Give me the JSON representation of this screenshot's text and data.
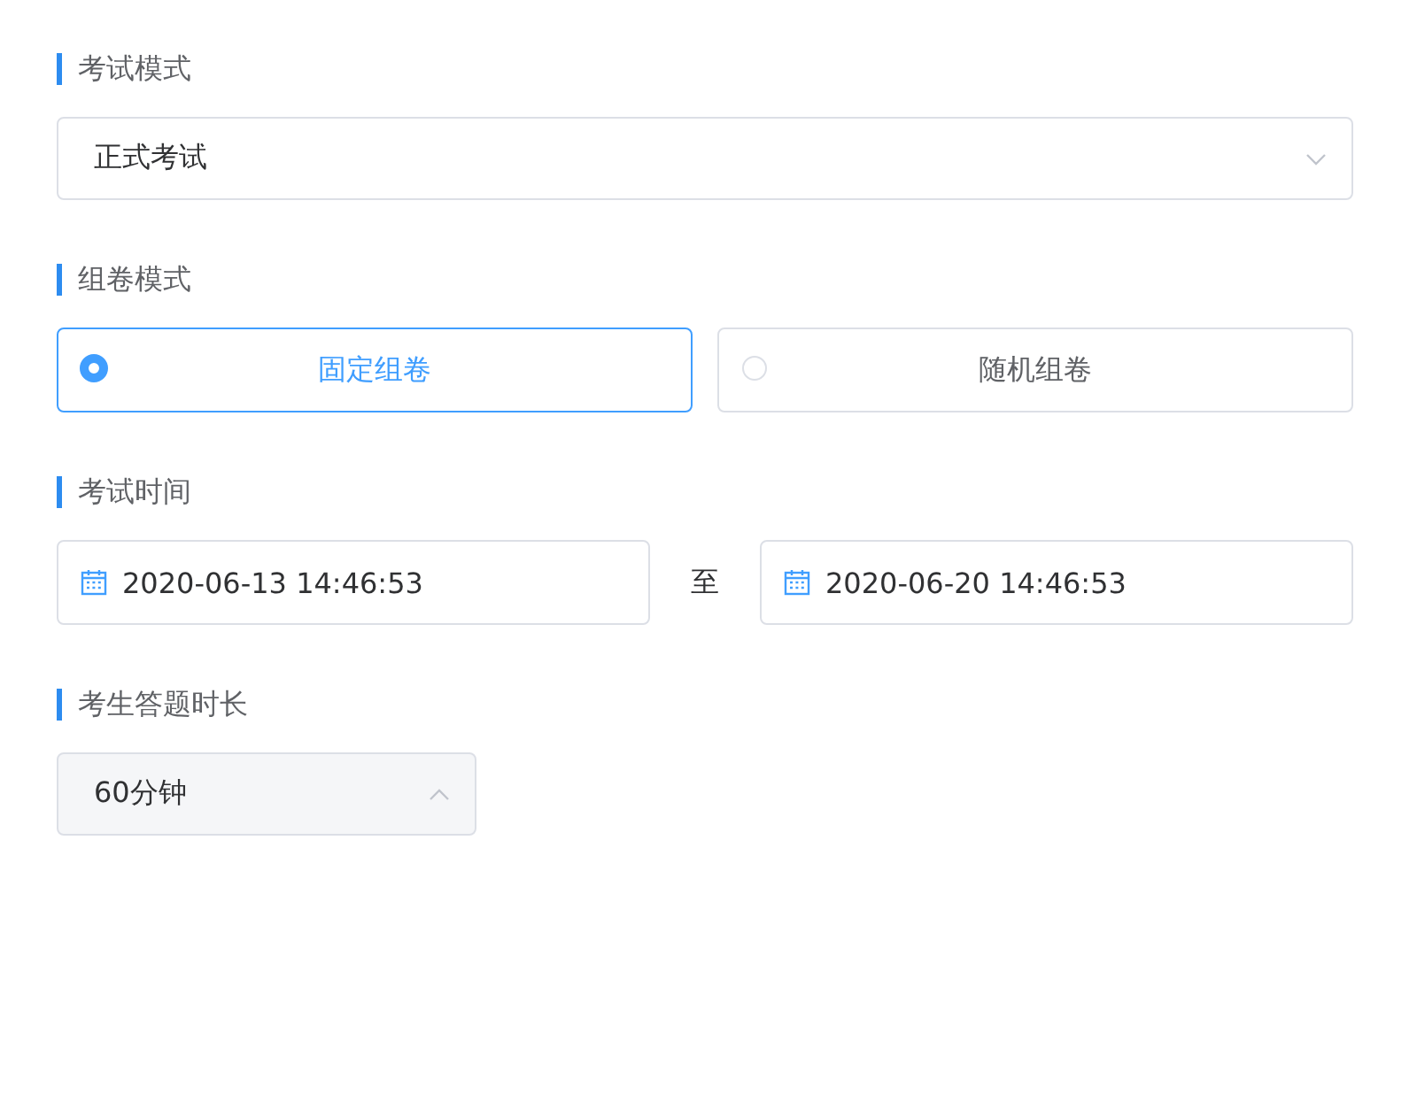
{
  "exam_mode": {
    "title": "考试模式",
    "value": "正式考试",
    "expanded": false
  },
  "compose_mode": {
    "title": "组卷模式",
    "options": [
      {
        "label": "固定组卷",
        "selected": true
      },
      {
        "label": "随机组卷",
        "selected": false
      }
    ]
  },
  "exam_time": {
    "title": "考试时间",
    "start": "2020-06-13 14:46:53",
    "separator": "至",
    "end": "2020-06-20 14:46:53"
  },
  "duration": {
    "title": "考生答题时长",
    "value": "60分钟",
    "expanded": true
  }
}
